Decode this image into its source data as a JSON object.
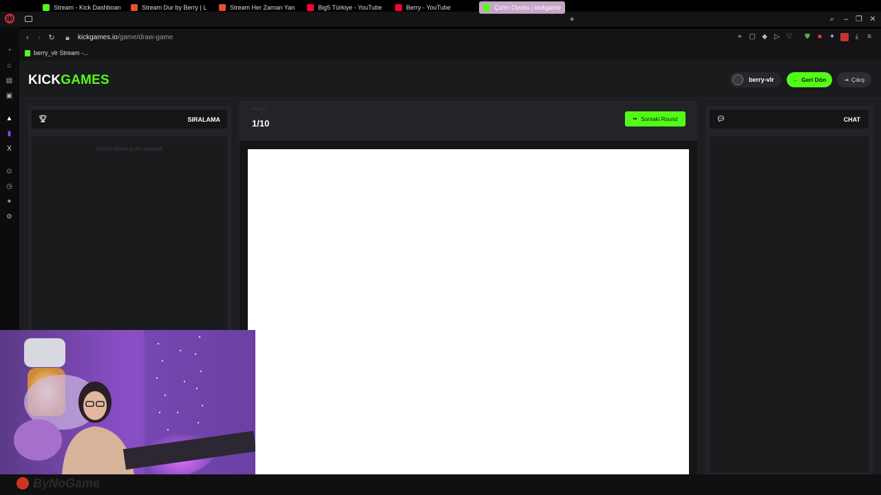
{
  "browser": {
    "tabs": [
      {
        "label": "Stream - Kick Dashboard",
        "color": "#53fc18"
      },
      {
        "label": "Stream Dur by Berry | Lis",
        "color": "#e8502e"
      },
      {
        "label": "Stream Her Zaman Yanınd",
        "color": "#e8502e"
      },
      {
        "label": "Big5 Türkiye - YouTube",
        "color": "#ff0033"
      },
      {
        "label": "Berry - YouTube",
        "color": "#ff0033"
      },
      {
        "label": "Çizim Oyunu | kickgames",
        "color": "#53fc18",
        "active": true
      }
    ],
    "new_tab": "+",
    "url_host": "kickgames.io",
    "url_path": "/game/draw-game",
    "bookmark": "berry_vlr Stream -..."
  },
  "app": {
    "logo_part1": "KICK",
    "logo_part2": "GAMES",
    "username": "berry-vlr",
    "back_label": "Geri Dön",
    "exit_label": "Çıkış",
    "accent": "#53fc18"
  },
  "leaderboard": {
    "title": "SIRALAMA",
    "empty": "Henüz kimse puan alamadı"
  },
  "round": {
    "label": "ROUND",
    "value": "1/10",
    "next_label": "Sonraki Round"
  },
  "chat": {
    "title": "CHAT"
  },
  "overlay": {
    "watermark": "ByNoGame"
  }
}
